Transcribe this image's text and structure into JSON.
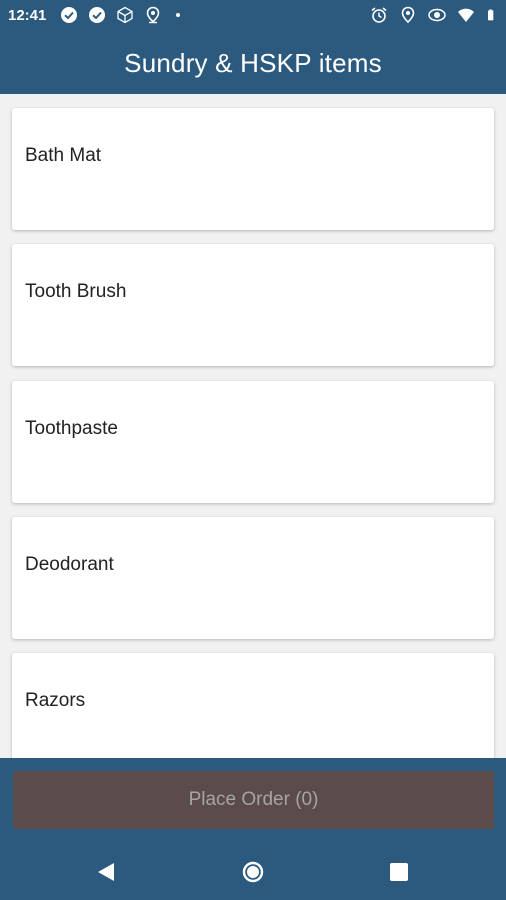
{
  "status_bar": {
    "time": "12:41",
    "left_icons": [
      "check-circle-icon",
      "check-circle-icon",
      "cube-icon",
      "location-icon",
      "dot-icon"
    ],
    "right_icons": [
      "alarm-icon",
      "location-icon",
      "eye-icon",
      "wifi-icon",
      "battery-icon"
    ]
  },
  "app_bar": {
    "title": "Sundry & HSKP items"
  },
  "items": [
    {
      "label": "Bath Mat"
    },
    {
      "label": "Tooth Brush"
    },
    {
      "label": "Toothpaste"
    },
    {
      "label": "Deodorant"
    },
    {
      "label": "Razors"
    }
  ],
  "footer": {
    "place_order_label": "Place Order (0)"
  },
  "nav_bar": {
    "buttons": [
      "back-icon",
      "home-icon",
      "recents-icon"
    ]
  },
  "colors": {
    "primary": "#2c5a7e",
    "order_button": "#5b4b4b",
    "order_text": "#a5a5a5"
  }
}
